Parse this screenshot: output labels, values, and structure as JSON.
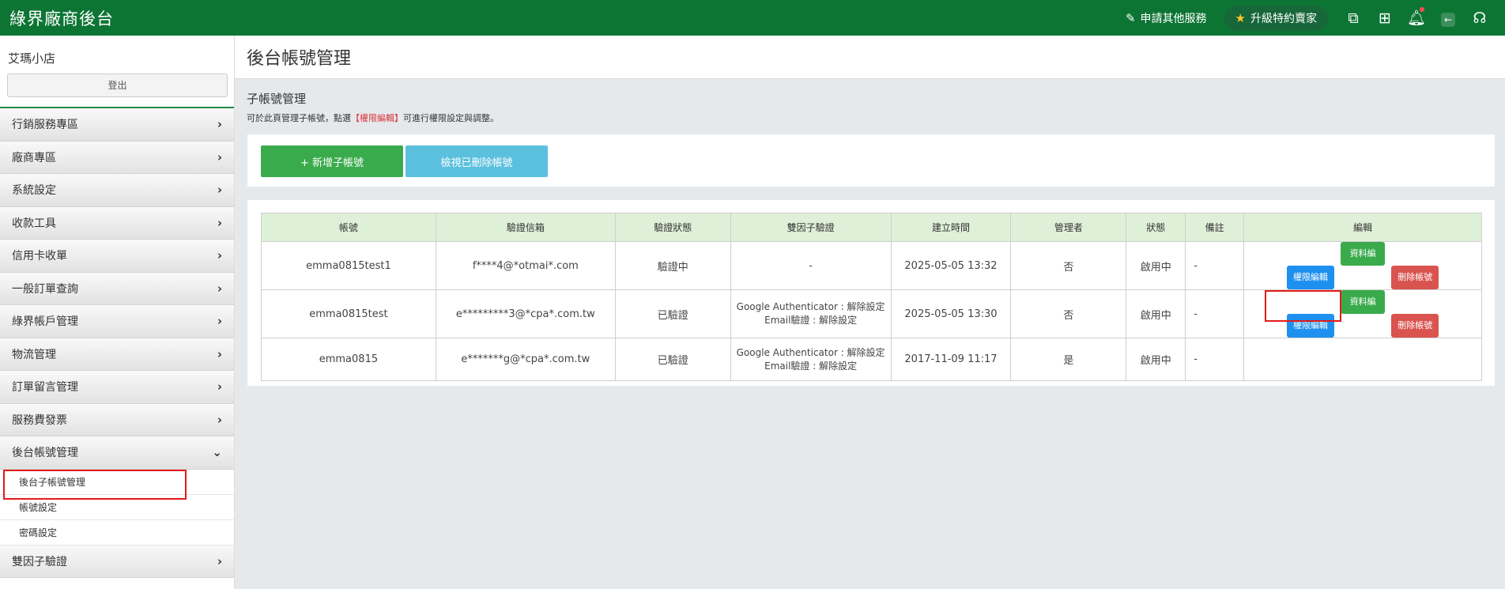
{
  "header": {
    "brand": "綠界廠商後台",
    "apply_service": "申請其他服務",
    "upgrade": "升級特約賣家"
  },
  "sidebar": {
    "store_name": "艾瑪小店",
    "logout": "登出",
    "items": [
      {
        "label": "行銷服務專區"
      },
      {
        "label": "廠商專區"
      },
      {
        "label": "系統設定"
      },
      {
        "label": "收款工具"
      },
      {
        "label": "信用卡收單"
      },
      {
        "label": "一般訂單查詢"
      },
      {
        "label": "綠界帳戶管理"
      },
      {
        "label": "物流管理"
      },
      {
        "label": "訂單留言管理"
      },
      {
        "label": "服務費發票"
      },
      {
        "label": "後台帳號管理"
      }
    ],
    "subitems": [
      {
        "label": "後台子帳號管理"
      },
      {
        "label": "帳號設定"
      },
      {
        "label": "密碼設定"
      }
    ],
    "last_item": {
      "label": "雙因子驗證"
    }
  },
  "main": {
    "page_title": "後台帳號管理",
    "section_title": "子帳號管理",
    "desc_before": "可於此頁管理子帳號，點選",
    "desc_link": "【權限編輯】",
    "desc_after": "可進行權限設定與調整。",
    "add_button": "+ 新增子帳號",
    "view_deleted_button": "檢視已刪除帳號"
  },
  "table": {
    "headers": [
      "帳號",
      "驗證信箱",
      "驗證狀態",
      "雙因子驗證",
      "建立時間",
      "管理者",
      "狀態",
      "備註",
      "編輯"
    ],
    "rows": [
      {
        "account": "emma0815test1",
        "email": "f****4@*otmai*.com",
        "verify_status": "驗證中",
        "twofa_line1": "-",
        "twofa_line2": "",
        "created": "2025-05-05 13:32",
        "admin": "否",
        "status": "啟用中",
        "note": "-",
        "perm_btn": "權限編輯",
        "data_btn": "資料編輯",
        "del_btn": "刪除帳號"
      },
      {
        "account": "emma0815test",
        "email": "e*********3@*cpa*.com.tw",
        "verify_status": "已驗證",
        "twofa_line1": "Google Authenticator : 解除設定",
        "twofa_line2": "Email驗證 : 解除設定",
        "created": "2025-05-05 13:30",
        "admin": "否",
        "status": "啟用中",
        "note": "-",
        "perm_btn": "權限編輯",
        "data_btn": "資料編輯",
        "del_btn": "刪除帳號"
      },
      {
        "account": "emma0815",
        "email": "e*******g@*cpa*.com.tw",
        "verify_status": "已驗證",
        "twofa_line1": "Google Authenticator : 解除設定",
        "twofa_line2": "Email驗證 : 解除設定",
        "created": "2017-11-09 11:17",
        "admin": "是",
        "status": "啟用中",
        "note": "-"
      }
    ]
  },
  "colors": {
    "topbar": "#0d7534",
    "highlight": "#e31b1b",
    "perm_button": "#1e90f0",
    "data_button": "#3aab4c",
    "delete_button": "#d9534f"
  }
}
